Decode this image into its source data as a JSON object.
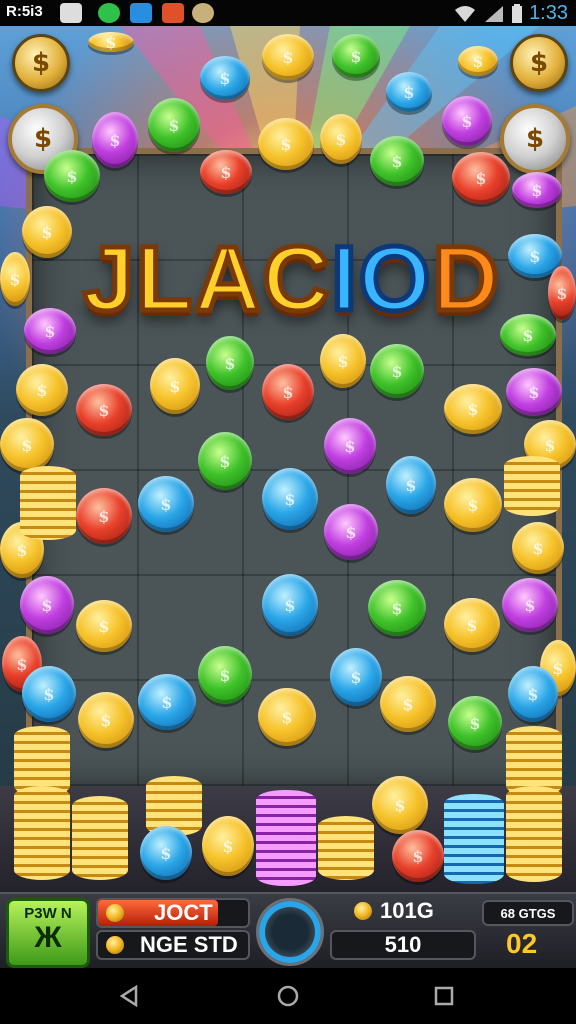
{
  "status_bar": {
    "time_left": "R:5i3",
    "time_right": "1:33"
  },
  "game_title": {
    "part1": "JLAC",
    "part2": "IO",
    "part3": "D"
  },
  "hud": {
    "play_button": {
      "line1": "P3W N",
      "line2": "Ж"
    },
    "top_bar_text": "JOCT",
    "top_bar_fill": 0.8,
    "bottom_bar_text": "NGE STD",
    "right_top_value": "101G",
    "right_score": "510",
    "right_badge": "68 GTGS",
    "right_multiplier": "02"
  },
  "colors": {
    "gold": "#f6c22a",
    "accent_blue": "#2aa6e8",
    "play_green": "#3e9a1a"
  },
  "icons": [
    "dollar-coin-icon",
    "back-icon",
    "home-icon",
    "recents-icon"
  ]
}
